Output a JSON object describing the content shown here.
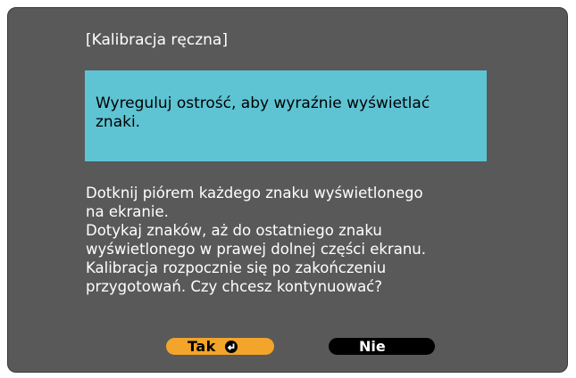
{
  "dialog": {
    "title": "[Kalibracja ręczna]",
    "message": "Wyreguluj ostrość, aby wyraźnie wyświetlać znaki.",
    "message_lines": [
      "Wyreguluj ostrość, aby wyraźnie wyświetlać",
      "znaki."
    ],
    "instructions": [
      "Dotknij piórem każdego znaku wyświetlonego",
      "na ekranie.",
      "Dotykaj znaków, aż do ostatniego znaku",
      "wyświetlonego w prawej dolnej części ekranu.",
      "Kalibracja rozpocznie się po zakończeniu",
      "przygotowań. Czy chcesz kontynuować?"
    ]
  },
  "buttons": {
    "yes_label": "Tak",
    "yes_icon": "enter-icon",
    "no_label": "Nie"
  },
  "colors": {
    "screen_background": "#595959",
    "message_background": "#5ec4d4",
    "selected_button": "#f2a52a",
    "unselected_button": "#000000"
  }
}
